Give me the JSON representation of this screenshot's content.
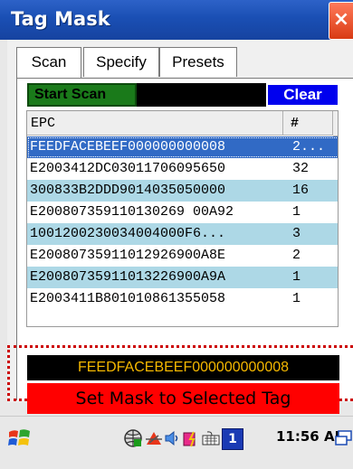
{
  "window": {
    "title": "Tag Mask",
    "close_label": "×"
  },
  "tabs": [
    {
      "label": "Scan"
    },
    {
      "label": "Specify"
    },
    {
      "label": "Presets"
    }
  ],
  "toolbar": {
    "start_label": "Start Scan",
    "clear_label": "Clear"
  },
  "table": {
    "columns": [
      "EPC",
      "#"
    ],
    "rows": [
      {
        "epc": "FEEDFACEBEEF000000000008",
        "count": "2..."
      },
      {
        "epc": "E2003412DC03011706095650",
        "count": "32"
      },
      {
        "epc": "300833B2DDD9014035050000",
        "count": "16"
      },
      {
        "epc": "E200807359110130269 00A92",
        "count": "1"
      },
      {
        "epc": "1001200230034004000F6...",
        "count": "3"
      },
      {
        "epc": "E20080735911012926900A8E",
        "count": "2"
      },
      {
        "epc": "E20080735911013226900A9A",
        "count": "1"
      },
      {
        "epc": "E2003411B801010861355058",
        "count": "1"
      }
    ]
  },
  "mask": {
    "selected_epc": "FEEDFACEBEEF000000000008",
    "set_label": "Set Mask to Selected Tag"
  },
  "taskbar": {
    "time": "11:56 AM",
    "badge": "1"
  }
}
